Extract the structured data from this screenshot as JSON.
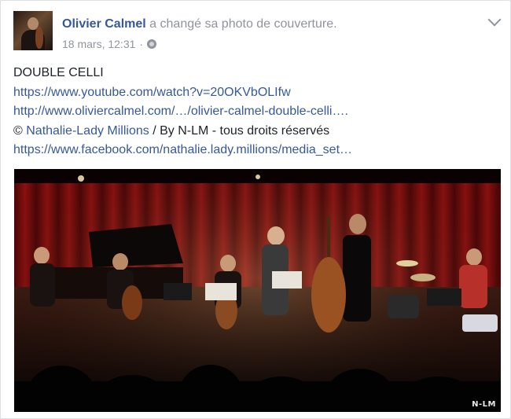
{
  "post": {
    "author_name": "Olivier Calmel",
    "action_text": "a changé sa photo de couverture.",
    "timestamp": "18 mars, 12:31",
    "separator": "·",
    "privacy_icon": "globe-icon",
    "menu_icon": "chevron-down-icon",
    "body": {
      "title": "DOUBLE CELLI",
      "youtube_link": "https://www.youtube.com/watch?v=20OKVbOLIfw",
      "site_link": "http://www.oliviercalmel.com/…/olivier-calmel-double-celli….",
      "credit_prefix": "© ",
      "credit_link": "Nathalie-Lady Millions",
      "credit_suffix": " / By N-LM - tous droits réservés",
      "facebook_link": "https://www.facebook.com/nathalie.lady.millions/media_set…"
    },
    "photo": {
      "watermark": "N-LM"
    }
  },
  "colors": {
    "link": "#365899",
    "meta": "#90949c",
    "text": "#1d2129",
    "curtain": "#7a0c0c"
  }
}
